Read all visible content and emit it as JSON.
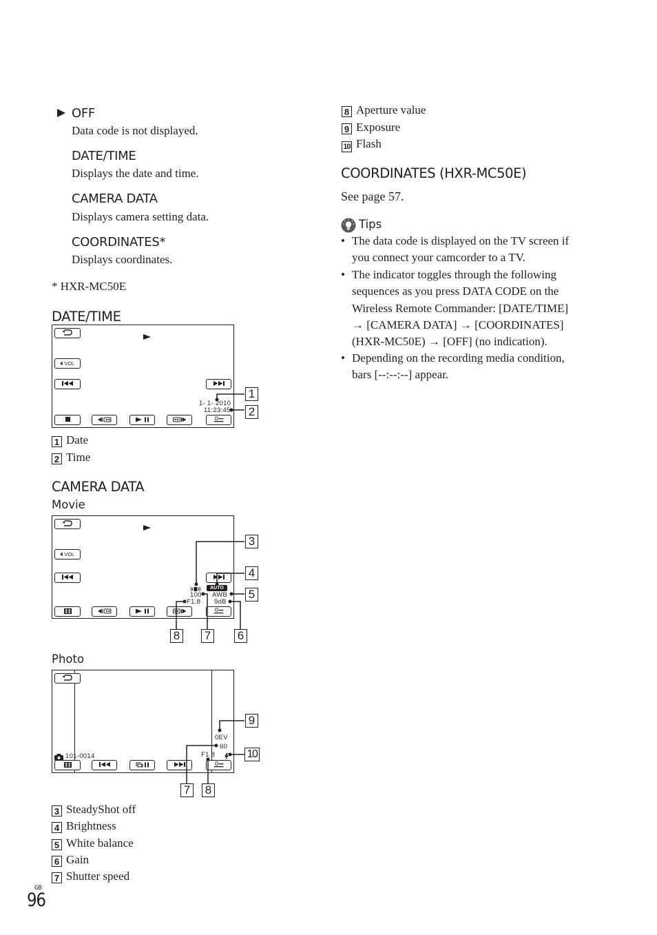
{
  "options": {
    "marker_icon": "triangle-right-icon",
    "items": [
      {
        "label": "OFF",
        "description": "Data code is not displayed.",
        "default": true
      },
      {
        "label": "DATE/TIME",
        "description": "Displays the date and time."
      },
      {
        "label": "CAMERA DATA",
        "description": "Displays camera setting data."
      },
      {
        "label": "COORDINATES*",
        "description": "Displays coordinates."
      }
    ],
    "footnote": "*  HXR-MC50E"
  },
  "date_time_section": {
    "title": "DATE/TIME",
    "screen": {
      "date": "1- 1- 2010",
      "time": "11:23:45",
      "vol_label": "VOL",
      "buttons": [
        "back",
        "volume",
        "previous",
        "next",
        "stop",
        "slow-reverse",
        "play-pause",
        "slow-forward",
        "option-menu"
      ]
    },
    "callouts": [
      "1",
      "2"
    ],
    "legend": [
      {
        "num": "1",
        "label": "Date"
      },
      {
        "num": "2",
        "label": "Time"
      }
    ]
  },
  "camera_data_section": {
    "title": "CAMERA DATA",
    "movie": {
      "subtitle": "Movie",
      "vol_label": "VOL",
      "brightness_badge": "AUTO",
      "shutter": "100",
      "white_balance": "AWB",
      "aperture": "F1.8",
      "gain": "9dB",
      "callouts": [
        "3",
        "4",
        "5",
        "8",
        "7",
        "6"
      ]
    },
    "photo": {
      "subtitle": "Photo",
      "file_number": "101-0014",
      "exposure": "0EV",
      "shutter": "60",
      "aperture": "F1.8",
      "flash_icon": "flash-icon",
      "callouts": [
        "9",
        "10",
        "7",
        "8"
      ]
    },
    "legend": [
      {
        "num": "3",
        "label": "SteadyShot off"
      },
      {
        "num": "4",
        "label": "Brightness"
      },
      {
        "num": "5",
        "label": "White balance"
      },
      {
        "num": "6",
        "label": "Gain"
      },
      {
        "num": "7",
        "label": "Shutter speed"
      },
      {
        "num": "8",
        "label": "Aperture value"
      },
      {
        "num": "9",
        "label": "Exposure"
      },
      {
        "num": "10",
        "label": "Flash"
      }
    ]
  },
  "coordinates_section": {
    "title": "COORDINATES (HXR-MC50E)",
    "text": "See page 57."
  },
  "tips": {
    "title": "Tips",
    "items": [
      {
        "lines": [
          "The data code is displayed on the TV screen if",
          "you connect your camcorder to a TV."
        ]
      },
      {
        "lines": [
          "The indicator toggles through the following",
          "sequences as you press DATA CODE on the",
          "Wireless Remote Commander: [DATE/TIME]",
          "→ [CAMERA DATA] → [COORDINATES]",
          "(HXR-MC50E) → [OFF] (no indication)."
        ]
      },
      {
        "lines": [
          "Depending on the recording media condition,",
          "bars [--:--:--] appear."
        ]
      }
    ]
  },
  "footer": {
    "region": "GB",
    "page_number": "96"
  }
}
